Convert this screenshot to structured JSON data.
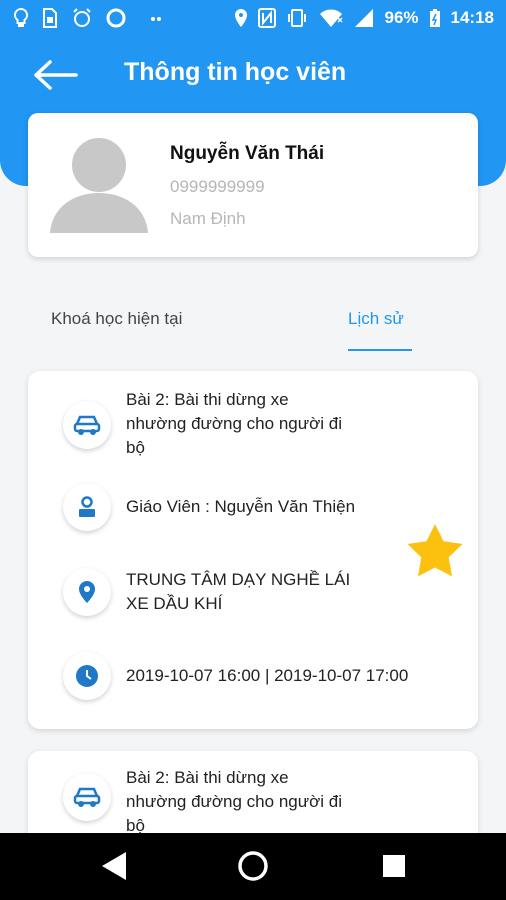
{
  "status_bar": {
    "battery": "96%",
    "time": "14:18",
    "left_icons": [
      "lightbulb-icon",
      "sim-card-icon",
      "alarm-icon",
      "circle-icon",
      "dots-icon"
    ],
    "right_icons": [
      "location-icon",
      "nfc-icon",
      "vibrate-icon",
      "wifi-icon",
      "signal-icon",
      "battery-icon"
    ]
  },
  "header": {
    "title": "Thông tin học viên"
  },
  "profile": {
    "name": "Nguyễn Văn Thái",
    "phone": "0999999999",
    "city": "Nam Định"
  },
  "tabs": [
    {
      "label": "Khoá học hiện tại",
      "active": false
    },
    {
      "label": "Lịch sử",
      "active": true
    }
  ],
  "cards": [
    {
      "lesson_line1": "Bài 2: Bài thi dừng xe",
      "lesson_line2": "nhường đường cho người đi",
      "lesson_line3": "bộ",
      "teacher": "Giáo Viên : Nguyễn Văn Thiện",
      "center_line1": "TRUNG TÂM DẠY NGHỀ LÁI",
      "center_line2": "XE DẦU KHÍ",
      "time": "2019-10-07 16:00 | 2019-10-07 17:00",
      "favorite": true
    },
    {
      "lesson_line1": "Bài 2: Bài thi dừng xe",
      "lesson_line2": "nhường đường cho người đi",
      "lesson_line3": "bộ"
    }
  ],
  "colors": {
    "primary": "#2196f3",
    "star": "#fbc10e",
    "icon": "#1f78c8"
  }
}
